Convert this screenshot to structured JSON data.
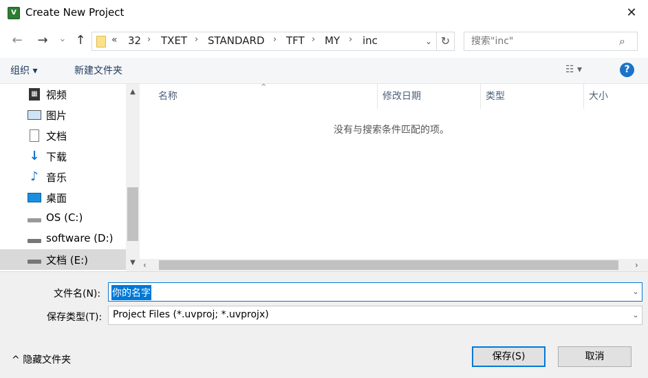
{
  "window": {
    "title": "Create New Project",
    "close_glyph": "✕",
    "app_icon": "uvision-icon"
  },
  "nav": {
    "back_glyph": "←",
    "forward_glyph": "→",
    "recent_glyph": "⌄",
    "up_glyph": "↑",
    "address_prefix": "«",
    "breadcrumbs": [
      "32",
      "TXET",
      "STANDARD",
      "TFT",
      "MY",
      "inc"
    ],
    "separator": "›"
  },
  "search": {
    "placeholder": "搜索\"inc\""
  },
  "toolbar": {
    "organize": "组织 ▾",
    "new_folder": "新建文件夹",
    "view": "☷ ▾",
    "help": "?"
  },
  "sidebar": {
    "items": [
      {
        "label": "视频",
        "icon": "video-icon"
      },
      {
        "label": "图片",
        "icon": "pictures-icon"
      },
      {
        "label": "文档",
        "icon": "documents-icon"
      },
      {
        "label": "下载",
        "icon": "downloads-icon"
      },
      {
        "label": "音乐",
        "icon": "music-icon"
      },
      {
        "label": "桌面",
        "icon": "desktop-icon"
      },
      {
        "label": "OS (C:)",
        "icon": "os-drive-icon"
      },
      {
        "label": "software (D:)",
        "icon": "drive-icon"
      },
      {
        "label": "文档 (E:)",
        "icon": "drive-icon",
        "selected": true
      }
    ]
  },
  "filelist": {
    "columns": [
      "名称",
      "修改日期",
      "类型",
      "大小"
    ],
    "empty_message": "没有与搜索条件匹配的项。"
  },
  "form": {
    "filename_label": "文件名(N):",
    "filename_value": "你的名字",
    "filetype_label": "保存类型(T):",
    "filetype_value": "Project Files (*.uvproj; *.uvprojx)"
  },
  "footer": {
    "hide_folders": "隐藏文件夹",
    "save": "保存(S)",
    "cancel": "取消"
  },
  "colors": {
    "accent": "#0078d7",
    "help": "#1a73c8",
    "link": "#1e3a5f"
  }
}
